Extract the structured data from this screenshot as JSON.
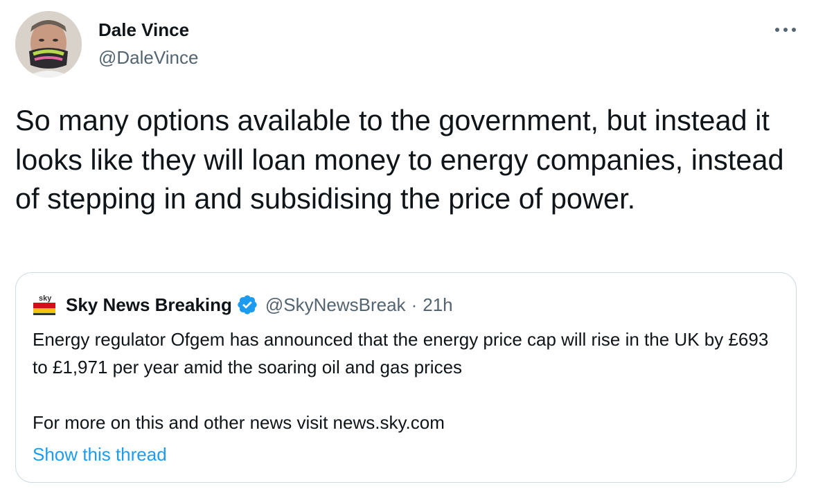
{
  "author": {
    "name": "Dale Vince",
    "handle": "@DaleVince",
    "avatar_icon": "profile-photo"
  },
  "menu_icon": "more-horizontal-icon",
  "tweet": {
    "text": "So many options available to the government, but instead it looks like they will loan money to energy companies, instead of stepping in and subsidising the price of power."
  },
  "quoted_tweet": {
    "logo_text": "sky",
    "author_name": "Sky News Breaking",
    "verified_icon": "verified-badge-icon",
    "handle": "@SkyNewsBreak",
    "separator": "·",
    "time": "21h",
    "text": "Energy regulator Ofgem has announced that the energy price cap will rise in the UK by £693 to £1,971 per year amid the soaring oil and gas prices",
    "text_more": "For more on this and other news visit news.sky.com",
    "show_thread": "Show this thread"
  },
  "colors": {
    "text": "#0f1419",
    "secondary": "#536471",
    "link": "#1d9bf0",
    "border": "#cfd9de",
    "sky_red": "#d0101c"
  }
}
